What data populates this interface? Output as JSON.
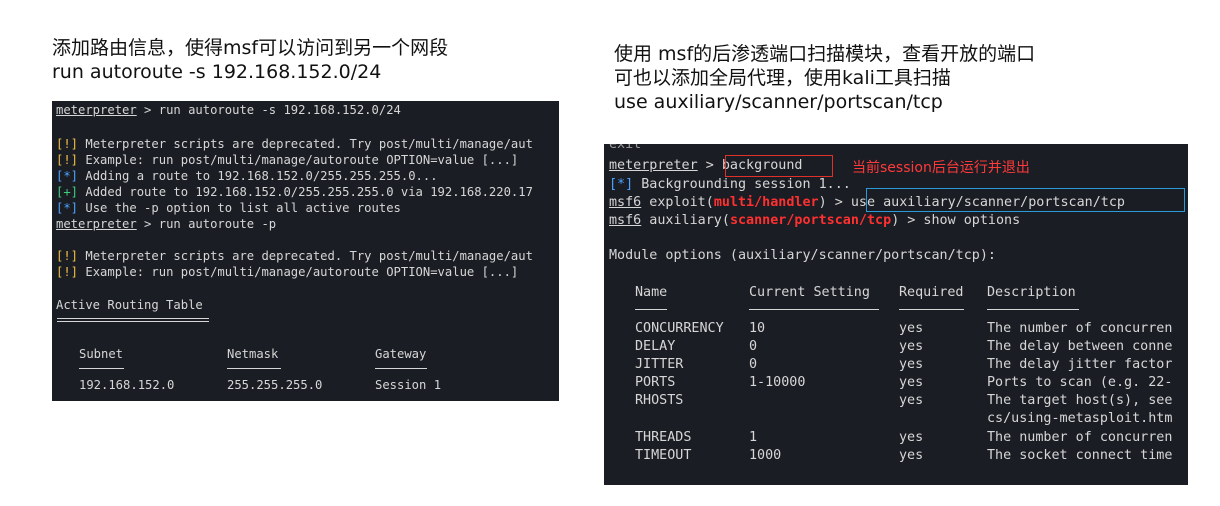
{
  "left_caption": {
    "line1": "添加路由信息，使得msf可以访问到另一个网段",
    "line2": "run autoroute -s 192.168.152.0/24"
  },
  "right_caption": {
    "line1": "使用 msf的后渗透端口扫描模块，查看开放的端口",
    "line2": "可也以添加全局代理，使用kali工具扫描",
    "line3": "use auxiliary/scanner/portscan/tcp"
  },
  "left_terminal": {
    "prompt": "meterpreter",
    "cmd1": " > run autoroute -s 192.168.152.0/24",
    "l1_tag": "[!]",
    "l1": " Meterpreter scripts are deprecated. Try post/multi/manage/aut",
    "l2_tag": "[!]",
    "l2": " Example: run post/multi/manage/autoroute OPTION=value [...]",
    "l3_tag": "[*]",
    "l3": " Adding a route to 192.168.152.0/255.255.255.0...",
    "l4_tag": "[+]",
    "l4": " Added route to 192.168.152.0/255.255.255.0 via 192.168.220.17",
    "l5_tag": "[*]",
    "l5": " Use the -p option to list all active routes",
    "cmd2": " > run autoroute -p",
    "l6_tag": "[!]",
    "l6": " Meterpreter scripts are deprecated. Try post/multi/manage/aut",
    "l7_tag": "[!]",
    "l7": " Example: run post/multi/manage/autoroute OPTION=value [...]",
    "table_title": "Active Routing Table",
    "headers": [
      "Subnet",
      "Netmask",
      "Gateway"
    ],
    "row": [
      "192.168.152.0",
      "255.255.255.0",
      "Session 1"
    ]
  },
  "right_terminal": {
    "top_fragment": "exit",
    "prompt": "meterpreter",
    "cmd_bg_pre": " > ",
    "cmd_bg": "background",
    "annotation": "当前session后台运行并退出",
    "bg_tag": "[*]",
    "bg_line": " Backgrounding session 1...",
    "msf6": "msf6",
    "exploit_pre": " exploit(",
    "exploit_mod": "multi/handler",
    "exploit_post": ") > ",
    "use_cmd": "use auxiliary/scanner/portscan/tcp",
    "aux_pre": " auxiliary(",
    "aux_mod": "scanner/portscan/tcp",
    "aux_post": ") > show options",
    "module_options": "Module options (auxiliary/scanner/portscan/tcp):",
    "headers": [
      "Name",
      "Current Setting",
      "Required",
      "Description"
    ],
    "rows": [
      [
        "CONCURRENCY",
        "10",
        "yes",
        "The number of concurren"
      ],
      [
        "DELAY",
        "0",
        "yes",
        "The delay between conne"
      ],
      [
        "JITTER",
        "0",
        "yes",
        "The delay jitter factor"
      ],
      [
        "PORTS",
        "1-10000",
        "yes",
        "Ports to scan (e.g. 22-"
      ],
      [
        "RHOSTS",
        "",
        "yes",
        "The target host(s), see"
      ],
      [
        "",
        "",
        "",
        "cs/using-metasploit.htm"
      ],
      [
        "THREADS",
        "1",
        "yes",
        "The number of concurren"
      ],
      [
        "TIMEOUT",
        "1000",
        "yes",
        "The socket connect time"
      ]
    ]
  }
}
